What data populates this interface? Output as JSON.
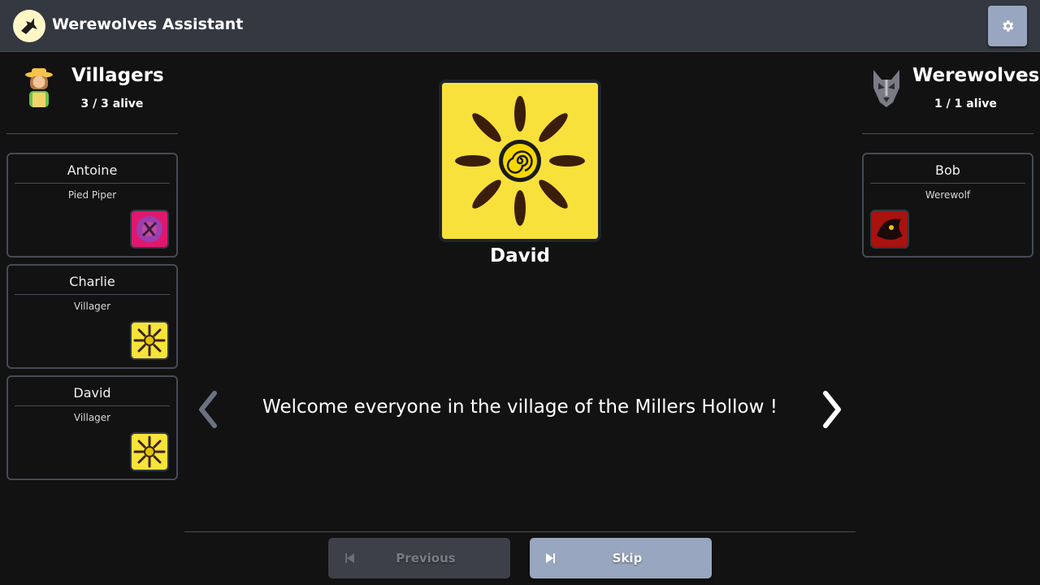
{
  "app": {
    "title": "Werewolves Assistant"
  },
  "villagers": {
    "title": "Villagers",
    "count": "3 / 3 alive",
    "players": [
      {
        "name": "Antoine",
        "role": "Pied Piper"
      },
      {
        "name": "Charlie",
        "role": "Villager"
      },
      {
        "name": "David",
        "role": "Villager"
      }
    ]
  },
  "werewolves": {
    "title": "Werewolves",
    "count": "1 / 1 alive",
    "players": [
      {
        "name": "Bob",
        "role": "Werewolf"
      }
    ]
  },
  "current": {
    "player_name": "David",
    "message": "Welcome everyone in the village of the Millers Hollow !"
  },
  "footer": {
    "previous_label": "Previous",
    "skip_label": "Skip"
  },
  "colors": {
    "background": "#121212",
    "topbar": "#343841",
    "accent": "#98a6c0",
    "card_border": "#454a57"
  }
}
